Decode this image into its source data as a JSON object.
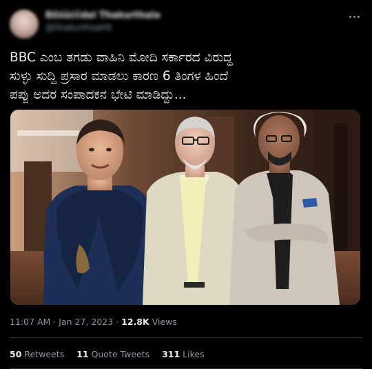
{
  "author": {
    "name": "Đžśůćčdal Thakurthala",
    "handle": "@ShakurthsaHit"
  },
  "tweet": {
    "text": "BBC ಎಂಬ ತಗಡು ವಾಹಿನಿ ಮೋದಿ ಸರ್ಕಾರದ ವಿರುದ್ಧ\nಸುಳ್ಳು ಸುದ್ದಿ ಪ್ರಸಾರ ಮಾಡಲು ಕಾರಣ 6 ತಿಂಗಳ ಹಿಂದೆ\nಪಪ್ಪು ಅದರ ಸಂಪಾದಕನ ಭೇಟಿ ಮಾಡಿದ್ದು...",
    "time": "11:07 AM",
    "separator": "·",
    "date": "Jan 27, 2023",
    "views_count": "12.8K",
    "views_label": "Views"
  },
  "stats": {
    "retweets_count": "50",
    "retweets_label": "Retweets",
    "quotes_count": "11",
    "quotes_label": "Quote Tweets",
    "likes_count": "311",
    "likes_label": "Likes"
  },
  "colors": {
    "background": "#000000",
    "text_primary": "#e7e9ea",
    "text_secondary": "#8b98a5",
    "divider": "#2f3336"
  },
  "icons": {
    "more": "more-horizontal-icon"
  }
}
